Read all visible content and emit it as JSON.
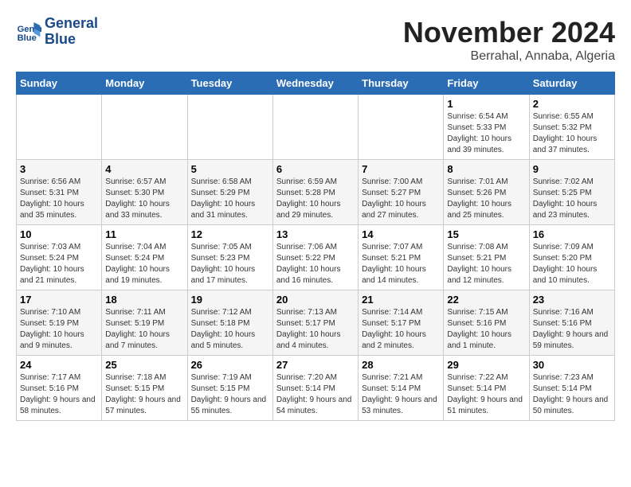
{
  "logo": {
    "line1": "General",
    "line2": "Blue"
  },
  "title": "November 2024",
  "subtitle": "Berrahal, Annaba, Algeria",
  "weekdays": [
    "Sunday",
    "Monday",
    "Tuesday",
    "Wednesday",
    "Thursday",
    "Friday",
    "Saturday"
  ],
  "weeks": [
    [
      {
        "day": "",
        "info": ""
      },
      {
        "day": "",
        "info": ""
      },
      {
        "day": "",
        "info": ""
      },
      {
        "day": "",
        "info": ""
      },
      {
        "day": "",
        "info": ""
      },
      {
        "day": "1",
        "info": "Sunrise: 6:54 AM\nSunset: 5:33 PM\nDaylight: 10 hours and 39 minutes."
      },
      {
        "day": "2",
        "info": "Sunrise: 6:55 AM\nSunset: 5:32 PM\nDaylight: 10 hours and 37 minutes."
      }
    ],
    [
      {
        "day": "3",
        "info": "Sunrise: 6:56 AM\nSunset: 5:31 PM\nDaylight: 10 hours and 35 minutes."
      },
      {
        "day": "4",
        "info": "Sunrise: 6:57 AM\nSunset: 5:30 PM\nDaylight: 10 hours and 33 minutes."
      },
      {
        "day": "5",
        "info": "Sunrise: 6:58 AM\nSunset: 5:29 PM\nDaylight: 10 hours and 31 minutes."
      },
      {
        "day": "6",
        "info": "Sunrise: 6:59 AM\nSunset: 5:28 PM\nDaylight: 10 hours and 29 minutes."
      },
      {
        "day": "7",
        "info": "Sunrise: 7:00 AM\nSunset: 5:27 PM\nDaylight: 10 hours and 27 minutes."
      },
      {
        "day": "8",
        "info": "Sunrise: 7:01 AM\nSunset: 5:26 PM\nDaylight: 10 hours and 25 minutes."
      },
      {
        "day": "9",
        "info": "Sunrise: 7:02 AM\nSunset: 5:25 PM\nDaylight: 10 hours and 23 minutes."
      }
    ],
    [
      {
        "day": "10",
        "info": "Sunrise: 7:03 AM\nSunset: 5:24 PM\nDaylight: 10 hours and 21 minutes."
      },
      {
        "day": "11",
        "info": "Sunrise: 7:04 AM\nSunset: 5:24 PM\nDaylight: 10 hours and 19 minutes."
      },
      {
        "day": "12",
        "info": "Sunrise: 7:05 AM\nSunset: 5:23 PM\nDaylight: 10 hours and 17 minutes."
      },
      {
        "day": "13",
        "info": "Sunrise: 7:06 AM\nSunset: 5:22 PM\nDaylight: 10 hours and 16 minutes."
      },
      {
        "day": "14",
        "info": "Sunrise: 7:07 AM\nSunset: 5:21 PM\nDaylight: 10 hours and 14 minutes."
      },
      {
        "day": "15",
        "info": "Sunrise: 7:08 AM\nSunset: 5:21 PM\nDaylight: 10 hours and 12 minutes."
      },
      {
        "day": "16",
        "info": "Sunrise: 7:09 AM\nSunset: 5:20 PM\nDaylight: 10 hours and 10 minutes."
      }
    ],
    [
      {
        "day": "17",
        "info": "Sunrise: 7:10 AM\nSunset: 5:19 PM\nDaylight: 10 hours and 9 minutes."
      },
      {
        "day": "18",
        "info": "Sunrise: 7:11 AM\nSunset: 5:19 PM\nDaylight: 10 hours and 7 minutes."
      },
      {
        "day": "19",
        "info": "Sunrise: 7:12 AM\nSunset: 5:18 PM\nDaylight: 10 hours and 5 minutes."
      },
      {
        "day": "20",
        "info": "Sunrise: 7:13 AM\nSunset: 5:17 PM\nDaylight: 10 hours and 4 minutes."
      },
      {
        "day": "21",
        "info": "Sunrise: 7:14 AM\nSunset: 5:17 PM\nDaylight: 10 hours and 2 minutes."
      },
      {
        "day": "22",
        "info": "Sunrise: 7:15 AM\nSunset: 5:16 PM\nDaylight: 10 hours and 1 minute."
      },
      {
        "day": "23",
        "info": "Sunrise: 7:16 AM\nSunset: 5:16 PM\nDaylight: 9 hours and 59 minutes."
      }
    ],
    [
      {
        "day": "24",
        "info": "Sunrise: 7:17 AM\nSunset: 5:16 PM\nDaylight: 9 hours and 58 minutes."
      },
      {
        "day": "25",
        "info": "Sunrise: 7:18 AM\nSunset: 5:15 PM\nDaylight: 9 hours and 57 minutes."
      },
      {
        "day": "26",
        "info": "Sunrise: 7:19 AM\nSunset: 5:15 PM\nDaylight: 9 hours and 55 minutes."
      },
      {
        "day": "27",
        "info": "Sunrise: 7:20 AM\nSunset: 5:14 PM\nDaylight: 9 hours and 54 minutes."
      },
      {
        "day": "28",
        "info": "Sunrise: 7:21 AM\nSunset: 5:14 PM\nDaylight: 9 hours and 53 minutes."
      },
      {
        "day": "29",
        "info": "Sunrise: 7:22 AM\nSunset: 5:14 PM\nDaylight: 9 hours and 51 minutes."
      },
      {
        "day": "30",
        "info": "Sunrise: 7:23 AM\nSunset: 5:14 PM\nDaylight: 9 hours and 50 minutes."
      }
    ]
  ]
}
